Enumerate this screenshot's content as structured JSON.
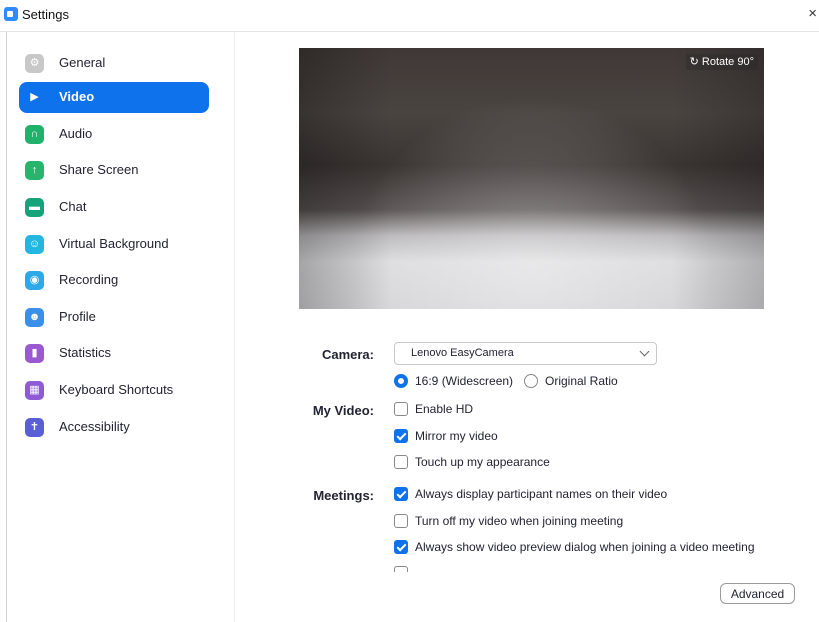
{
  "window": {
    "title": "Settings",
    "close_glyph": "×"
  },
  "sidebar": {
    "active_index": 1,
    "items": [
      {
        "label": "General",
        "icon": "gear-icon",
        "color": "#c8c8c8",
        "glyph": "⚙"
      },
      {
        "label": "Video",
        "icon": "video-camera-icon",
        "color": "#0e72ed",
        "glyph": "▶"
      },
      {
        "label": "Audio",
        "icon": "headphones-icon",
        "color": "#20b26b",
        "glyph": "∩"
      },
      {
        "label": "Share Screen",
        "icon": "share-screen-icon",
        "color": "#28b46d",
        "glyph": "↑"
      },
      {
        "label": "Chat",
        "icon": "chat-bubble-icon",
        "color": "#16a37a",
        "glyph": "▬"
      },
      {
        "label": "Virtual Background",
        "icon": "virtual-background-icon",
        "color": "#24b6e0",
        "glyph": "☺"
      },
      {
        "label": "Recording",
        "icon": "recording-icon",
        "color": "#2fa8e8",
        "glyph": "◉"
      },
      {
        "label": "Profile",
        "icon": "profile-icon",
        "color": "#3a8fe8",
        "glyph": "☻"
      },
      {
        "label": "Statistics",
        "icon": "statistics-icon",
        "color": "#9b59d0",
        "glyph": "▮"
      },
      {
        "label": "Keyboard Shortcuts",
        "icon": "keyboard-icon",
        "color": "#8e5ad6",
        "glyph": "▦"
      },
      {
        "label": "Accessibility",
        "icon": "accessibility-icon",
        "color": "#5b5fd6",
        "glyph": "✝"
      }
    ]
  },
  "preview": {
    "rotate_label": "Rotate 90°",
    "rotate_icon": "rotate-icon"
  },
  "camera": {
    "label": "Camera:",
    "selected": "Lenovo EasyCamera",
    "ratio_options": [
      {
        "label": "16:9 (Widescreen)",
        "selected": true
      },
      {
        "label": "Original Ratio",
        "selected": false
      }
    ]
  },
  "my_video": {
    "label": "My Video:",
    "options": [
      {
        "label": "Enable HD",
        "checked": false
      },
      {
        "label": "Mirror my video",
        "checked": true
      },
      {
        "label": "Touch up my appearance",
        "checked": false
      }
    ]
  },
  "meetings": {
    "label": "Meetings:",
    "options": [
      {
        "label": "Always display participant names on their video",
        "checked": true
      },
      {
        "label": "Turn off my video when joining meeting",
        "checked": false
      },
      {
        "label": "Always show video preview dialog when joining a video meeting",
        "checked": true
      }
    ]
  },
  "advanced_label": "Advanced",
  "colors": {
    "accent": "#0e72ed",
    "text": "#232333"
  }
}
